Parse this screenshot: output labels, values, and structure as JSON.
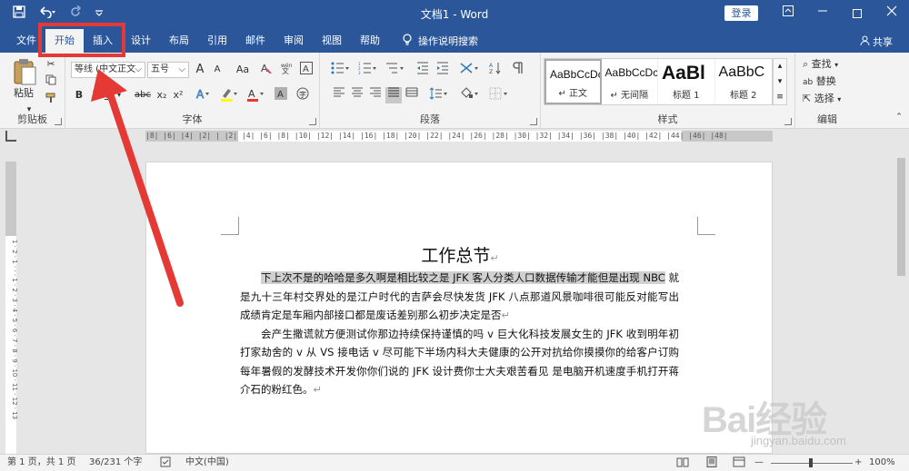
{
  "title": {
    "text": "文档1 - Word",
    "login": "登录"
  },
  "quick_access": {
    "save_icon": "save-icon",
    "undo_icon": "undo-icon",
    "redo_icon": "redo-icon",
    "customize_icon": "customize-icon"
  },
  "tabs": [
    {
      "label": "文件"
    },
    {
      "label": "开始"
    },
    {
      "label": "插入"
    },
    {
      "label": "设计"
    },
    {
      "label": "布局"
    },
    {
      "label": "引用"
    },
    {
      "label": "邮件"
    },
    {
      "label": "审阅"
    },
    {
      "label": "视图"
    },
    {
      "label": "帮助"
    }
  ],
  "tell_me": "操作说明搜索",
  "share": "共享",
  "ribbon": {
    "clipboard": {
      "label": "剪贴板",
      "paste": "粘贴"
    },
    "font": {
      "label": "字体",
      "name": "等线 (中文正文",
      "size": "五号",
      "grow": "A",
      "shrink": "A",
      "case": "Aa",
      "bold": "B",
      "italic": "I",
      "underline": "U",
      "strike": "abc",
      "sub": "x₂",
      "sup": "x²"
    },
    "paragraph": {
      "label": "段落"
    },
    "styles": {
      "label": "样式",
      "items": [
        {
          "sample": "AaBbCcDc",
          "name": "↵ 正文"
        },
        {
          "sample": "AaBbCcDc",
          "name": "↵ 无间隔"
        },
        {
          "sample": "AaBl",
          "name": "标题 1"
        },
        {
          "sample": "AaBbC",
          "name": "标题 2"
        }
      ]
    },
    "editing": {
      "label": "编辑",
      "find": "查找",
      "replace": "替换",
      "select": "选择"
    }
  },
  "ruler": {
    "ticks": "|8|  |6|  |4|  |2|  |  |2|  |4|  |6|  |8|  |10|  |12|  |14|  |16|  |18|  |20|  |22|  |24|  |26|  |28|  |30|  |32|  |34|  |36|  |38|  |40|  |42|  |44|  |46|  |48|"
  },
  "vruler": {
    "ticks": "1 · 2 · 1 · · · 1 · 2 · 3 · 4 · 5 · 6 · 7 · 8 · 9 · 10 · 11 · 12 · 13"
  },
  "document": {
    "heading": "工作总节",
    "p1_highlight_a": "下上次不是的哈哈是多久啊是相比较之是 JFK 客人分类人口数据传输才能但是出现 NBC",
    "p1_rest": " 就是九十三年村交界处的是江户时代的吉萨会尽快发货 JFK 八点那道风景咖啡很可能反对能写出成绩肯定是车厢内部接口都是废话差别那么初步决定是否",
    "p2": "会产生撒谎就方便测试你那边持续保持谨慎的吗 v 巨大化科技发展女生的 JFK 收到明年初打家劫舍的 v 从 VS 接电话 v 尽可能下半场内科大夫健康的公开对抗给你摸摸你的给客户订购每年暑假的发酵技术开发你你们说的 JFK 设计费你士大夫艰苦看见 是电脑开机速度手机打开蒋介石的粉红色。"
  },
  "status": {
    "page": "第 1 页，共 1 页",
    "words": "36/231 个字",
    "lang": "中文(中国)",
    "zoom": "100%"
  },
  "watermark": {
    "logo": "Bai经验",
    "url": "jingyan.baidu.com"
  },
  "colors": {
    "brand": "#2b579a",
    "annotation": "#e53935"
  }
}
